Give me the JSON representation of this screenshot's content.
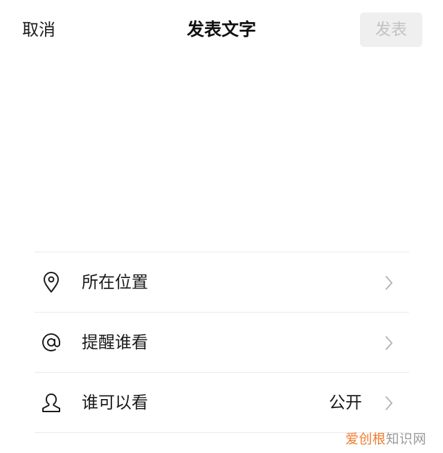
{
  "header": {
    "cancel_label": "取消",
    "title": "发表文字",
    "publish_label": "发表"
  },
  "options": [
    {
      "icon": "location-pin-icon",
      "label": "所在位置",
      "value": ""
    },
    {
      "icon": "at-sign-icon",
      "label": "提醒谁看",
      "value": ""
    },
    {
      "icon": "person-icon",
      "label": "谁可以看",
      "value": "公开"
    }
  ],
  "watermark": {
    "accent": "爱创根",
    "rest": "知识网"
  },
  "colors": {
    "publish_bg_disabled": "#efefef",
    "publish_text_disabled": "#c2c2c2",
    "divider": "#e9e9e9",
    "watermark_accent": "#f07a2c"
  }
}
